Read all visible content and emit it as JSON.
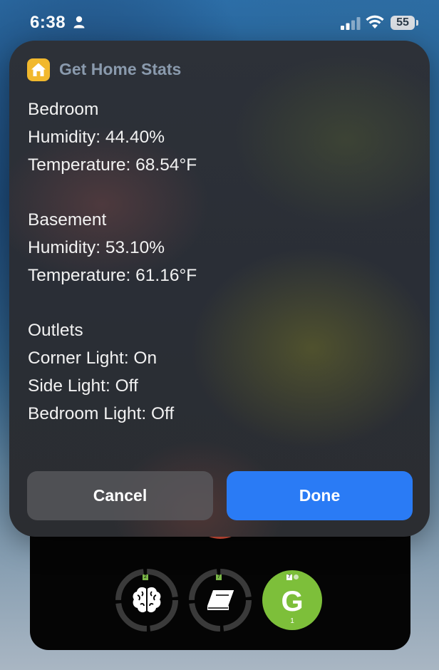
{
  "status_bar": {
    "time": "6:38",
    "battery": "55"
  },
  "dialog": {
    "app_title": "Get Home Stats",
    "app_icon": "home-icon",
    "accent_color": "#f1b82d",
    "lines": [
      "Bedroom",
      "Humidity: 44.40%",
      "Temperature: 68.54°F",
      "",
      "Basement",
      "Humidity: 53.10%",
      "Temperature: 61.16°F",
      "",
      "Outlets",
      "Corner Light: On",
      "Side Light: Off",
      "Bedroom Light: Off"
    ],
    "cancel_label": "Cancel",
    "done_label": "Done",
    "done_color": "#2a7bf5"
  },
  "widget": {
    "red_ring_count": "6",
    "rings": [
      {
        "icon": "brain-icon",
        "badge": "2"
      },
      {
        "icon": "book-icon",
        "badge": "7"
      }
    ],
    "g_tile": {
      "letter": "G",
      "badge": "7",
      "count": "1",
      "color": "#7dbf3a"
    }
  }
}
